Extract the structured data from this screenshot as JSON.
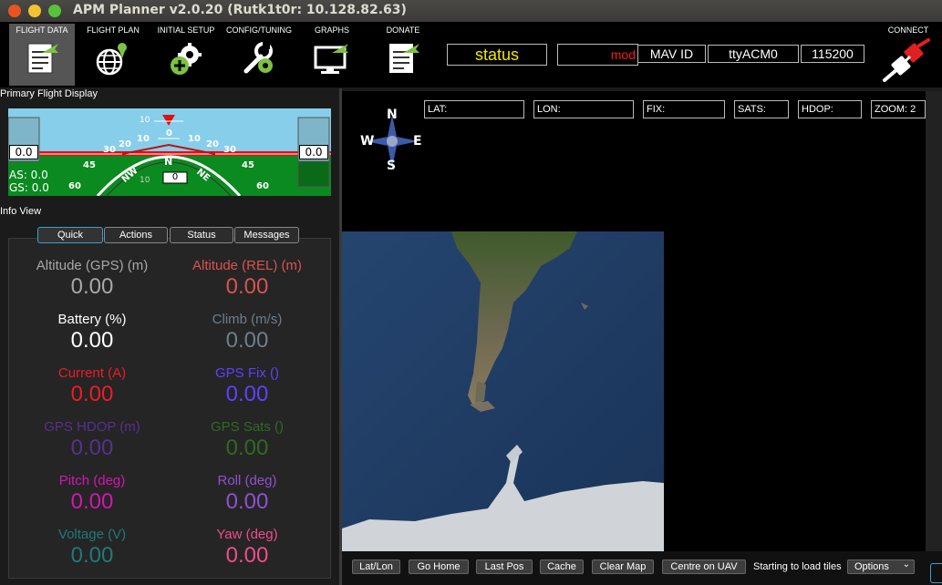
{
  "window": {
    "title": "APM Planner v2.0.20 (Rutk1t0r: 10.128.82.63)"
  },
  "toolbar": {
    "items": [
      {
        "label": "FLIGHT DATA",
        "icon": "flight-data-icon"
      },
      {
        "label": "FLIGHT PLAN",
        "icon": "flight-plan-icon"
      },
      {
        "label": "INITIAL SETUP",
        "icon": "initial-setup-icon"
      },
      {
        "label": "CONFIG/TUNING",
        "icon": "config-tuning-icon"
      },
      {
        "label": "GRAPHS",
        "icon": "graphs-icon"
      },
      {
        "label": "DONATE",
        "icon": "donate-icon"
      }
    ],
    "status": "status",
    "mode": "mod",
    "mav_id": "MAV ID",
    "port": "ttyACM0",
    "baud": "115200",
    "connect_label": "CONNECT"
  },
  "pfd": {
    "title": "Primary Flight Display",
    "left_value": "0.0",
    "right_value": "0.0",
    "airspeed": "AS: 0.0",
    "groundspeed": "GS: 0.0",
    "heading_value": "0",
    "heading_letter": "N",
    "ticks": [
      "10",
      "0",
      "10",
      "20",
      "30",
      "45",
      "60",
      "10",
      "20",
      "30",
      "45",
      "60"
    ],
    "compass_nw": "NW",
    "compass_ne": "NE",
    "bottom_tick": "10"
  },
  "info": {
    "title": "Info View",
    "tabs": [
      "Quick",
      "Actions",
      "Status",
      "Messages"
    ],
    "quick": [
      {
        "label": "Altitude (GPS) (m)",
        "value": "0.00",
        "color": "#a8a8a8"
      },
      {
        "label": "Altitude (REL) (m)",
        "value": "0.00",
        "color": "#d9534f"
      },
      {
        "label": "Battery (%)",
        "value": "0.00",
        "color": "#ffffff"
      },
      {
        "label": "Climb (m/s)",
        "value": "0.00",
        "color": "#6f7e8a"
      },
      {
        "label": "Current (A)",
        "value": "0.00",
        "color": "#ee1c24"
      },
      {
        "label": "GPS Fix ()",
        "value": "0.00",
        "color": "#6040ff"
      },
      {
        "label": "GPS HDOP (m)",
        "value": "0.00",
        "color": "#5a2f8f"
      },
      {
        "label": "GPS Sats ()",
        "value": "0.00",
        "color": "#2e6a22"
      },
      {
        "label": "Pitch (deg)",
        "value": "0.00",
        "color": "#d316b0"
      },
      {
        "label": "Roll (deg)",
        "value": "0.00",
        "color": "#9050d0"
      },
      {
        "label": "Voltage (V)",
        "value": "0.00",
        "color": "#1f7a7a"
      },
      {
        "label": "Yaw (deg)",
        "value": "0.00",
        "color": "#f04c8c"
      }
    ]
  },
  "map": {
    "fields": [
      "LAT:",
      "LON:",
      "FIX:",
      "SATS:",
      "HDOP:",
      "ZOOM: 2"
    ],
    "compass": {
      "n": "N",
      "s": "S",
      "e": "E",
      "w": "W"
    },
    "buttons": [
      "Lat/Lon",
      "Go Home",
      "Last Pos",
      "Cache",
      "Clear Map",
      "Centre on UAV"
    ],
    "status_text": "Starting to load tiles",
    "options_label": "Options"
  }
}
